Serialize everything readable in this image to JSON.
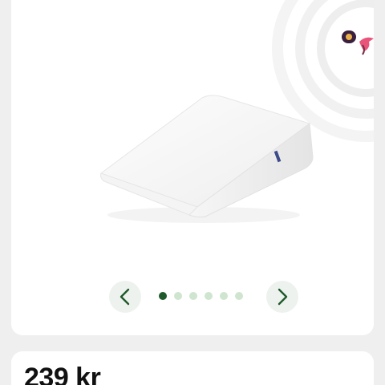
{
  "gallery": {
    "product_name_icon": "wedge-pillow-image",
    "prev_icon": "chevron-left-icon",
    "next_icon": "chevron-right-icon",
    "slide_count": 6,
    "active_slide": 1,
    "colors": {
      "accent": "#1e5a2b",
      "dot_inactive": "#cfe5cf",
      "nav_bg": "#eef2ee"
    }
  },
  "product": {
    "price": "239 kr"
  }
}
